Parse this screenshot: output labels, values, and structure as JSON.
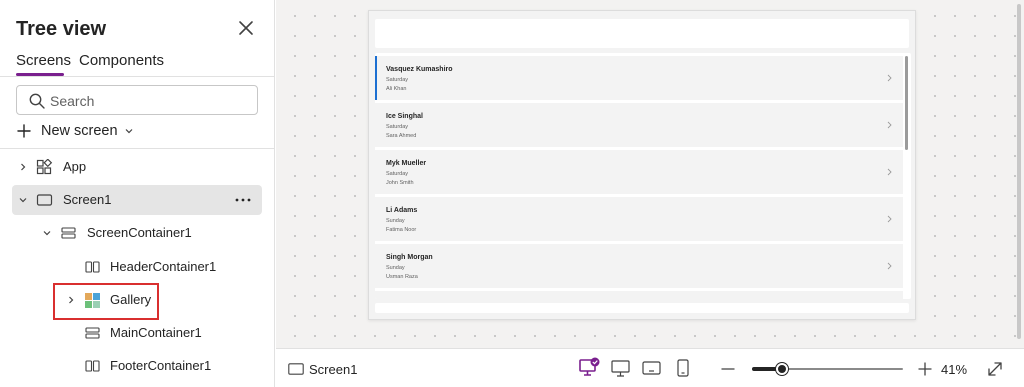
{
  "pane": {
    "title": "Tree view",
    "tabs": [
      {
        "label": "Screens",
        "active": true
      },
      {
        "label": "Components",
        "active": false
      }
    ],
    "search": {
      "placeholder": "Search",
      "value": ""
    },
    "new_screen_label": "New screen",
    "tree": [
      {
        "label": "App",
        "icon": "app-icon",
        "expander": "chevron-right",
        "selected": false
      },
      {
        "label": "Screen1",
        "icon": "screen-icon",
        "expander": "chevron-down",
        "selected": true
      },
      {
        "label": "ScreenContainer1",
        "icon": "vertical-container-icon",
        "expander": "chevron-down",
        "selected": false
      },
      {
        "label": "HeaderContainer1",
        "icon": "horizontal-container-icon",
        "expander": "",
        "selected": false
      },
      {
        "label": "Gallery",
        "icon": "gallery-icon",
        "expander": "chevron-right",
        "selected": false,
        "highlighted": true
      },
      {
        "label": "MainContainer1",
        "icon": "vertical-container-icon",
        "expander": "",
        "selected": false
      },
      {
        "label": "FooterContainer1",
        "icon": "horizontal-container-icon",
        "expander": "",
        "selected": false
      }
    ]
  },
  "gallery": {
    "items": [
      {
        "name": "Vasquez Kumashiro",
        "day": "Saturday",
        "person": "Ali Khan",
        "selected": true
      },
      {
        "name": "Ice Singhal",
        "day": "Saturday",
        "person": "Sara Ahmed",
        "selected": false
      },
      {
        "name": "Myk Mueller",
        "day": "Saturday",
        "person": "John Smith",
        "selected": false
      },
      {
        "name": "Li Adams",
        "day": "Sunday",
        "person": "Fatima Noor",
        "selected": false
      },
      {
        "name": "Singh Morgan",
        "day": "Sunday",
        "person": "Usman Raza",
        "selected": false
      }
    ]
  },
  "status_bar": {
    "screen_label": "Screen1",
    "zoom_label": "41%",
    "zoom_fraction": 0.2
  },
  "colors": {
    "accent": "#7a1f8e",
    "selection_bar": "#1b6fd1",
    "highlight_border": "#d92f2f",
    "canvas_bg": "#f3f2f1"
  }
}
